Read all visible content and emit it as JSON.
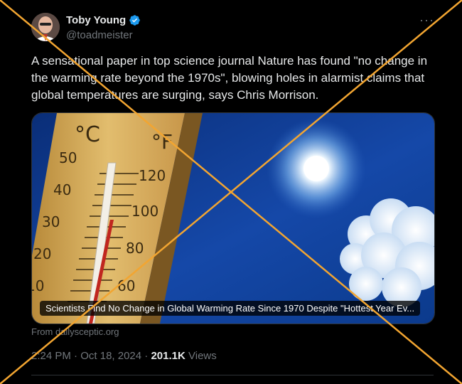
{
  "author": {
    "name": "Toby Young",
    "handle": "@toadmeister",
    "verified": true
  },
  "more_icon": "···",
  "tweet_text": "A sensational paper in top science journal Nature has found \"no change in the warming rate beyond the 1970s\", blowing holes in alarmist claims that global temperatures are surging, says Chris Morrison.",
  "card": {
    "thermometer_unit_c": "°C",
    "thermometer_unit_f": "°F",
    "celsius_ticks": [
      "50",
      "40",
      "30",
      "20",
      "10"
    ],
    "fahrenheit_ticks": [
      "120",
      "100",
      "80",
      "60"
    ],
    "headline": "Scientists Find No Change in Global Warming Rate Since 1970 Despite \"Hottest Year Ev...",
    "source": "From dailysceptic.org"
  },
  "meta": {
    "time": "2:24 PM",
    "separator": "·",
    "date": "Oct 18, 2024",
    "views_count": "201.1K",
    "views_label": "Views"
  },
  "overlay": {
    "type": "cross-out",
    "color": "#f2a531"
  }
}
